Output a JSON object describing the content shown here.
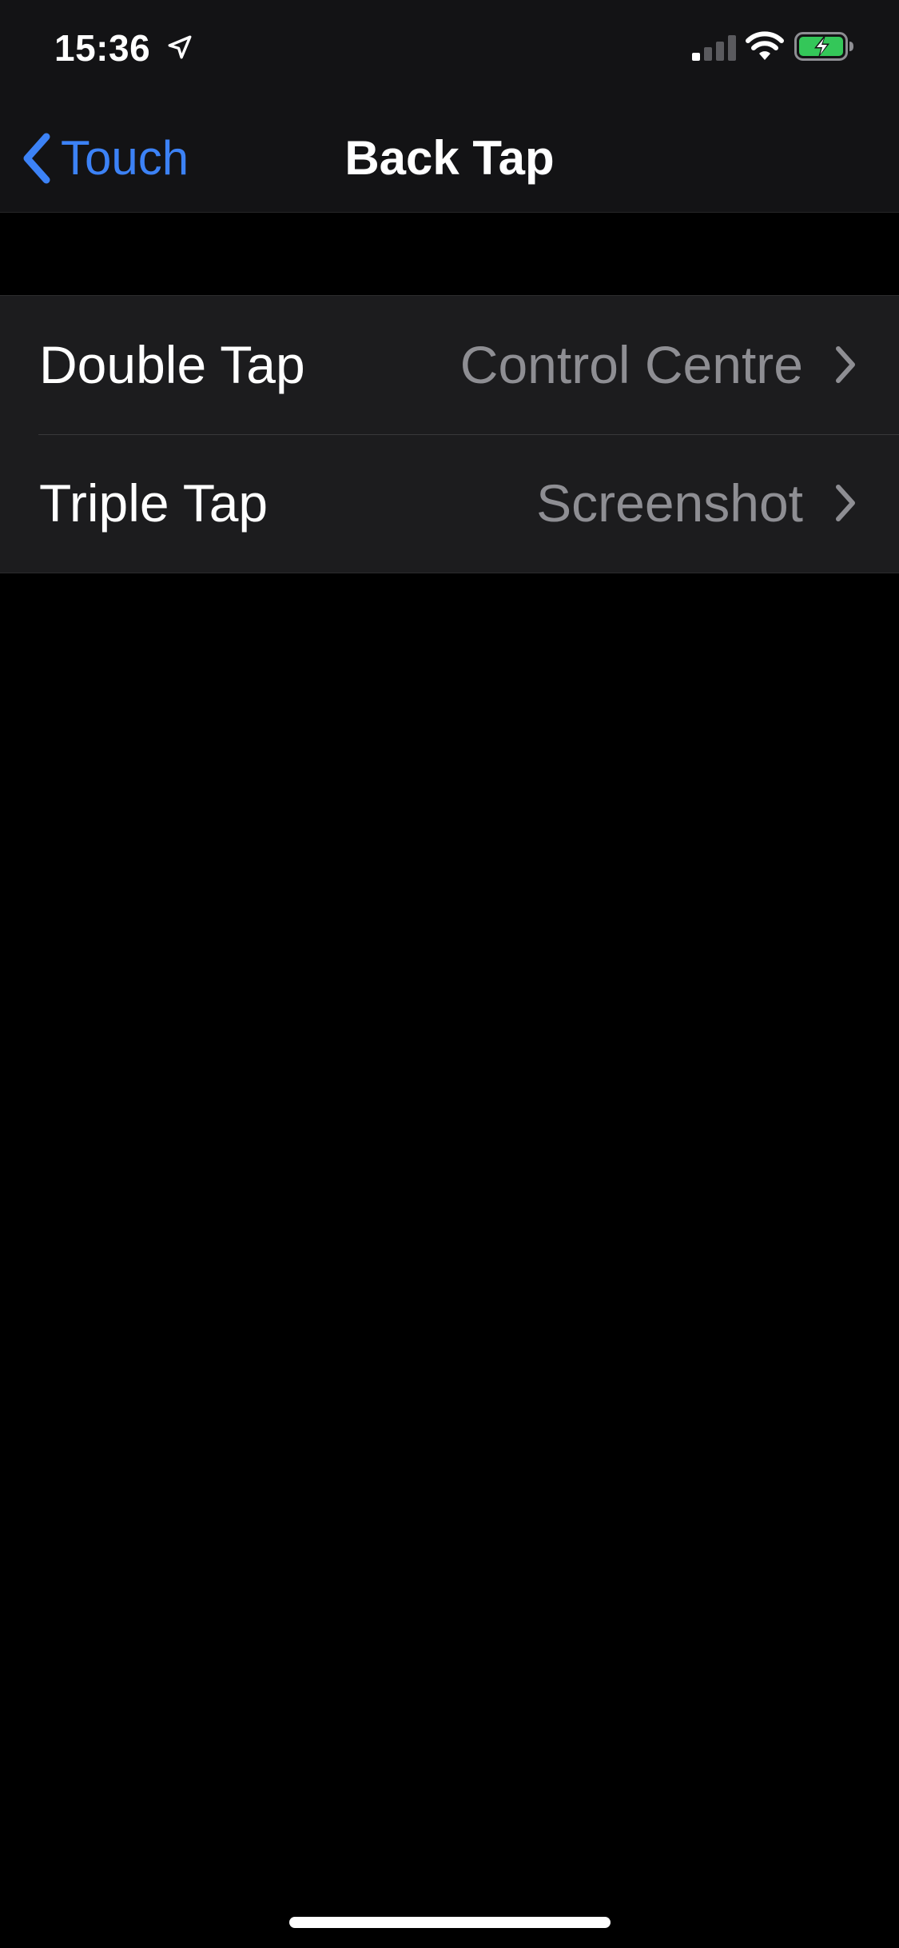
{
  "status_bar": {
    "time": "15:36",
    "location_icon": "location-arrow-icon",
    "signal_icon": "cellular-signal-icon",
    "wifi_icon": "wifi-icon",
    "battery_icon": "battery-charging-icon",
    "battery_color": "#34c759"
  },
  "nav": {
    "back_label": "Touch",
    "title": "Back Tap",
    "accent_color": "#3c82f6"
  },
  "settings": {
    "rows": [
      {
        "label": "Double Tap",
        "value": "Control Centre"
      },
      {
        "label": "Triple Tap",
        "value": "Screenshot"
      }
    ]
  }
}
